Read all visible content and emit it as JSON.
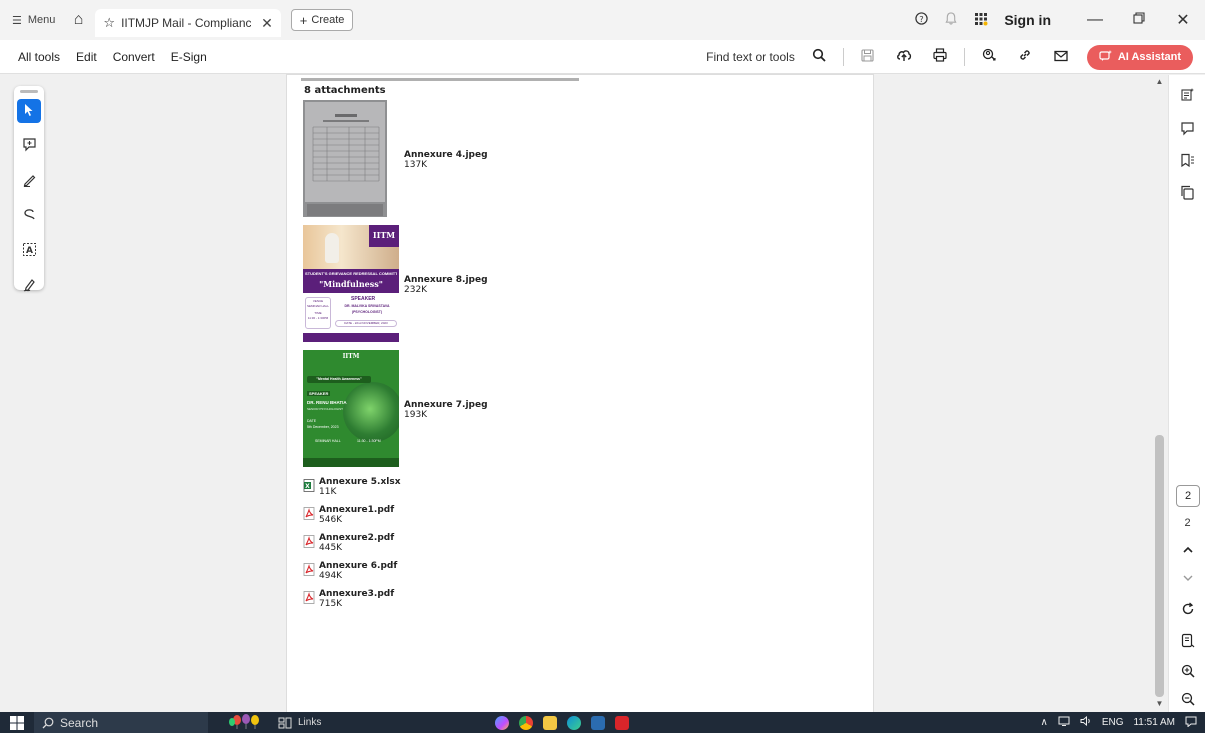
{
  "tabbar": {
    "menu_label": "Menu",
    "tab_title": "IITMJP Mail - Complianc...",
    "create_label": "Create",
    "sign_in": "Sign in"
  },
  "toolbar": {
    "menu_items": [
      "All tools",
      "Edit",
      "Convert",
      "E-Sign"
    ],
    "find_text": "Find text or tools",
    "ai_assistant": "AI Assistant"
  },
  "document": {
    "header": "8 attachments",
    "image_attachments": [
      {
        "name": "Annexure 4.jpeg",
        "size": "137K"
      },
      {
        "name": "Annexure 8.jpeg",
        "size": "232K"
      },
      {
        "name": "Annexure 7.jpeg",
        "size": "193K"
      }
    ],
    "file_attachments": [
      {
        "name": "Annexure 5.xlsx",
        "size": "11K",
        "type": "xlsx"
      },
      {
        "name": "Annexure1.pdf",
        "size": "546K",
        "type": "pdf"
      },
      {
        "name": "Annexure2.pdf",
        "size": "445K",
        "type": "pdf"
      },
      {
        "name": "Annexure 6.pdf",
        "size": "494K",
        "type": "pdf"
      },
      {
        "name": "Annexure3.pdf",
        "size": "715K",
        "type": "pdf"
      }
    ],
    "thumb8": {
      "logo": "IITM",
      "committee": "STUDENT'S GRIEVANCE REDRESSAL COMMITTEE",
      "topic": "\"Mindfulness\"",
      "speaker_heading": "SPEAKER",
      "speaker_name": "DR. MALVIKA SRIVASTAVA",
      "speaker_role": "(PSYCHOLOGIST)",
      "venue_label": "VENUE",
      "venue": "SEMINAR HALL",
      "time_label": "TIME",
      "time": "11:30 - 1:30PM",
      "date": "DATE - 22nd NOVEMBER, 2023"
    },
    "thumb7": {
      "logo": "IITM",
      "topic": "\"Mental Health Awareness\"",
      "speaker_heading": "SPEAKER",
      "speaker_name": "DR. RENU BHATIA",
      "speaker_role": "SENIOR PSYCHOLOGIST",
      "date_label": "DATE",
      "date": "5th December, 2023",
      "venue": "SEMINAR HALL",
      "time": "11:30 - 1:30PM"
    }
  },
  "pager": {
    "current": "2",
    "total": "2"
  },
  "taskbar": {
    "search": "Search",
    "links": "Links",
    "lang": "ENG",
    "time": "11:51 AM"
  },
  "colors": {
    "accent": "#1473e6",
    "ai_button": "#ea5d5d",
    "taskbar": "#1f2a38",
    "thumb8_purple": "#5b1f7a",
    "thumb7_green": "#2f8a2f"
  }
}
